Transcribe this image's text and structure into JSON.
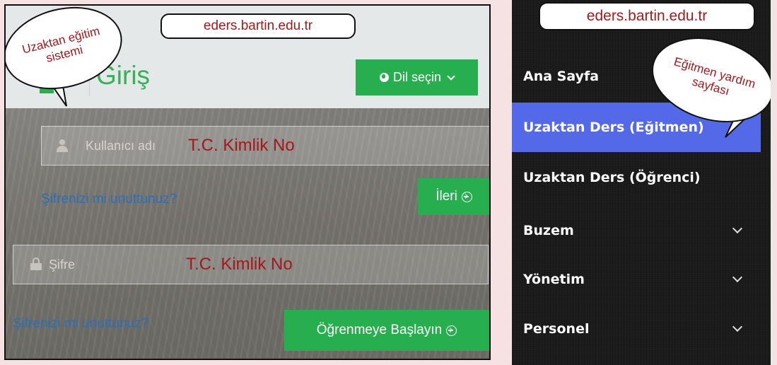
{
  "url": "eders.bartin.edu.tr",
  "login": {
    "title": "Giriş",
    "lang_button": "Dil seçin",
    "username_placeholder": "Kullanıcı adı",
    "username_note": "T.C. Kimlik No",
    "forgot_1": "Şifrenizi mi unuttunuz?",
    "next_button": "İleri",
    "password_placeholder": "Şifre",
    "password_note": "T.C. Kimlik No",
    "forgot_2": "Şifrenizi mi unuttunuz?",
    "start_button": "Öğrenmeye Başlayın",
    "bubble_line1": "Uzaktan eğitim",
    "bubble_line2": "sistemi"
  },
  "menu": {
    "items": [
      {
        "label": "Ana Sayfa",
        "active": false,
        "expandable": false
      },
      {
        "label": "Uzaktan Ders (Eğitmen)",
        "active": true,
        "expandable": false
      },
      {
        "label": "Uzaktan Ders (Öğrenci)",
        "active": false,
        "expandable": false
      },
      {
        "label": "Buzem",
        "active": false,
        "expandable": true
      },
      {
        "label": "Yönetim",
        "active": false,
        "expandable": true
      },
      {
        "label": "Personel",
        "active": false,
        "expandable": true
      }
    ],
    "bubble_line1": "Eğitmen yardım",
    "bubble_line2": "sayfası"
  },
  "colors": {
    "accent_green": "#27ae4f",
    "active_blue": "#5369e8",
    "annotation_red": "#a4181c",
    "link_blue": "#2b6fb7"
  }
}
